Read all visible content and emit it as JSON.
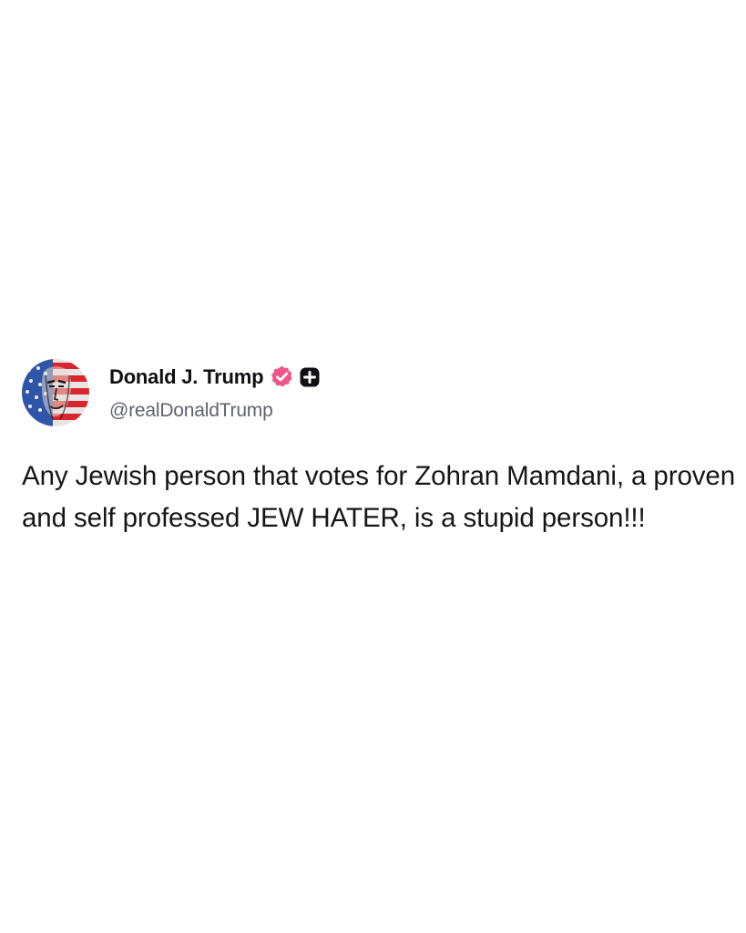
{
  "post": {
    "author": {
      "display_name": "Donald J. Trump",
      "handle": "@realDonaldTrump",
      "avatar_icon": "flag-portrait-avatar",
      "verified_icon": "verified-badge-icon",
      "plus_icon": "plus-badge-icon",
      "verified_color": "#f0568a",
      "plus_badge_color": "#0f0f14"
    },
    "text": "Any Jewish person that votes for Zohran Mamdani, a proven and self professed JEW HATER, is a stupid person!!!"
  }
}
